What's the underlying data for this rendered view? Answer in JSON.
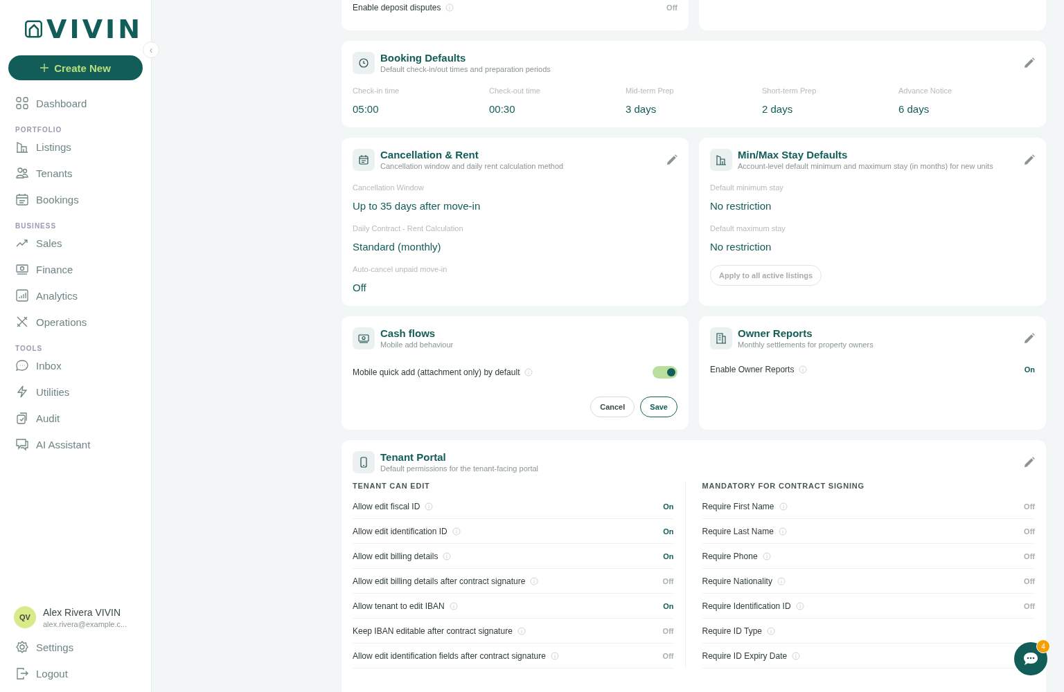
{
  "sidebar": {
    "logo": "VIVIN",
    "create_button": "Create New",
    "collapse_glyph": "‹",
    "sections": [
      {
        "items": [
          {
            "label": "Dashboard",
            "selected": false
          }
        ]
      },
      {
        "title": "PORTFOLIO",
        "items": [
          {
            "label": "Listings",
            "selected": false
          },
          {
            "label": "Tenants",
            "selected": false
          },
          {
            "label": "Bookings",
            "selected": false
          }
        ]
      },
      {
        "title": "BUSINESS",
        "items": [
          {
            "label": "Sales",
            "selected": false
          },
          {
            "label": "Finance",
            "selected": false
          },
          {
            "label": "Analytics",
            "selected": false
          },
          {
            "label": "Operations",
            "selected": false
          }
        ]
      },
      {
        "title": "TOOLS",
        "items": [
          {
            "label": "Inbox",
            "selected": false
          },
          {
            "label": "Utilities",
            "selected": false
          },
          {
            "label": "Audit",
            "selected": false
          },
          {
            "label": "AI Assistant",
            "selected": false
          }
        ]
      }
    ],
    "user": {
      "initials": "QV",
      "name": "Alex Rivera VIVIN",
      "email": "alex.rivera@example.c..."
    },
    "footer_items": [
      {
        "label": "Settings"
      },
      {
        "label": "Logout"
      }
    ]
  },
  "top_card": {
    "label": "Enable deposit disputes",
    "value": "Off",
    "on": false
  },
  "booking_defaults": {
    "title": "Booking Defaults",
    "subtitle": "Default check-in/out times and preparation periods",
    "fields": [
      {
        "label": "Check-in time",
        "value": "05:00"
      },
      {
        "label": "Check-out time",
        "value": "00:30"
      },
      {
        "label": "Mid-term Prep",
        "value": "3 days"
      },
      {
        "label": "Short-term Prep",
        "value": "2 days"
      },
      {
        "label": "Advance Notice",
        "value": "6 days"
      }
    ]
  },
  "cancellation": {
    "title": "Cancellation & Rent",
    "subtitle": "Cancellation window and daily rent calculation method",
    "fields": [
      {
        "label": "Cancellation Window",
        "value": "Up to 35 days after move-in"
      },
      {
        "label": "Daily Contract - Rent Calculation",
        "value": "Standard (monthly)"
      },
      {
        "label": "Auto-cancel unpaid move-in",
        "value": "Off"
      }
    ]
  },
  "min_max_stay": {
    "title": "Min/Max Stay Defaults",
    "subtitle": "Account-level default minimum and maximum stay (in months) for new units",
    "fields": [
      {
        "label": "Default minimum stay",
        "value": "No restriction"
      },
      {
        "label": "Default maximum stay",
        "value": "No restriction"
      }
    ],
    "apply_button": "Apply to all active listings"
  },
  "cash_flows": {
    "title": "Cash flows",
    "subtitle": "Mobile add behaviour",
    "toggle_label": "Mobile quick add (attachment only) by default",
    "toggle_on": true,
    "buttons": [
      "Cancel",
      "Save"
    ]
  },
  "owner_reports": {
    "title": "Owner Reports",
    "subtitle": "Monthly settlements for property owners",
    "label": "Enable Owner Reports",
    "value": "On",
    "on": true
  },
  "tenant_portal": {
    "title": "Tenant Portal",
    "subtitle": "Default permissions for the tenant-facing portal",
    "columns": [
      {
        "heading": "TENANT CAN EDIT",
        "rows": [
          {
            "label": "Allow edit fiscal ID",
            "value": "On",
            "on": true
          },
          {
            "label": "Allow edit identification ID",
            "value": "On",
            "on": true
          },
          {
            "label": "Allow edit billing details",
            "value": "On",
            "on": true
          },
          {
            "label": "Allow edit billing details after contract signature",
            "value": "Off",
            "on": false
          },
          {
            "label": "Allow tenant to edit IBAN",
            "value": "On",
            "on": true
          },
          {
            "label": "Keep IBAN editable after contract signature",
            "value": "Off",
            "on": false
          },
          {
            "label": "Allow edit identification fields after contract signature",
            "value": "Off",
            "on": false
          }
        ]
      },
      {
        "heading": "MANDATORY FOR CONTRACT SIGNING",
        "rows": [
          {
            "label": "Require First Name",
            "value": "Off",
            "on": false
          },
          {
            "label": "Require Last Name",
            "value": "Off",
            "on": false
          },
          {
            "label": "Require Phone",
            "value": "Off",
            "on": false
          },
          {
            "label": "Require Nationality",
            "value": "Off",
            "on": false
          },
          {
            "label": "Require Identification ID",
            "value": "Off",
            "on": false
          },
          {
            "label": "Require ID Type"
          },
          {
            "label": "Require ID Expiry Date"
          }
        ]
      }
    ]
  },
  "chat_badge": "4"
}
